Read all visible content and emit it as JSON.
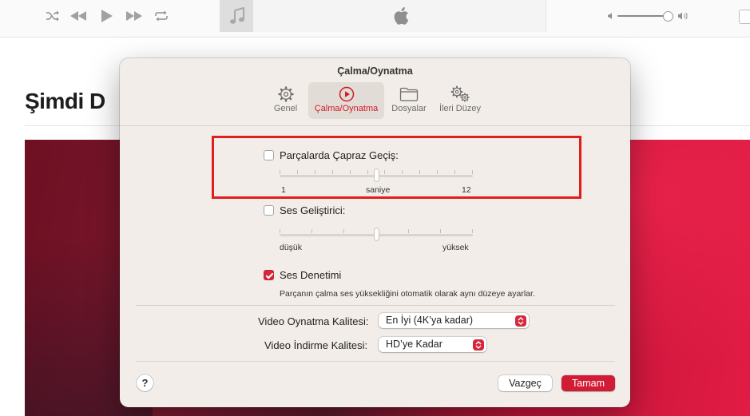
{
  "background": {
    "page_title": "Şimdi D",
    "colors": {
      "banner_start": "#6e0f22",
      "banner_end": "#e21c44"
    }
  },
  "toolbar": {
    "icons": [
      "shuffle-icon",
      "rewind-icon",
      "play-icon",
      "fast-forward-icon",
      "repeat-icon",
      "music-note-icon",
      "apple-logo-icon",
      "volume-low-icon",
      "volume-high-icon"
    ],
    "volume_level": 0.9
  },
  "dialog": {
    "title": "Çalma/Oynatma",
    "tabs": [
      {
        "label": "Genel",
        "icon": "gear-icon",
        "active": false
      },
      {
        "label": "Çalma/Oynatma",
        "icon": "play-circle-icon",
        "active": true
      },
      {
        "label": "Dosyalar",
        "icon": "folder-icon",
        "active": false
      },
      {
        "label": "İleri Düzey",
        "icon": "gears-icon",
        "active": false
      }
    ],
    "crossfade": {
      "label": "Parçalarda Çapraz Geçiş:",
      "checked": false,
      "min_label": "1",
      "unit_label": "saniye",
      "max_label": "12",
      "value_fraction": 0.5
    },
    "sound_enhancer": {
      "label": "Ses Geliştirici:",
      "checked": false,
      "min_label": "düşük",
      "max_label": "yüksek",
      "value_fraction": 0.5
    },
    "sound_check": {
      "label": "Ses Denetimi",
      "checked": true,
      "description": "Parçanın çalma ses yüksekliğini otomatik olarak aynı düzeye ayarlar."
    },
    "video_playback_quality": {
      "label": "Video Oynatma Kalitesi:",
      "value": "En İyi (4K’ya kadar)"
    },
    "video_download_quality": {
      "label": "Video İndirme Kalitesi:",
      "value": "HD’ye Kadar"
    },
    "help_label": "?",
    "cancel_label": "Vazgeç",
    "ok_label": "Tamam",
    "colors": {
      "accent": "#d7273a",
      "highlight_box": "#e21d1d",
      "dialog_bg": "#f2ede8"
    }
  }
}
